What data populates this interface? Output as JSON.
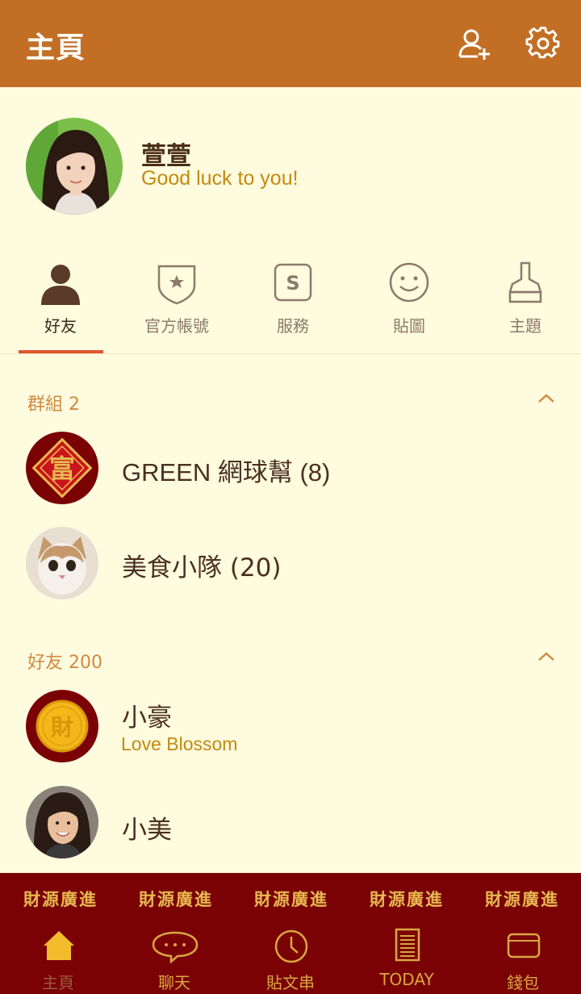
{
  "header": {
    "title": "主頁"
  },
  "profile": {
    "name": "萱萱",
    "status": "Good luck to you!"
  },
  "tabs": [
    {
      "label": "好友",
      "icon": "person-icon",
      "active": true
    },
    {
      "label": "官方帳號",
      "icon": "shield-star-icon"
    },
    {
      "label": "服務",
      "icon": "service-s-icon"
    },
    {
      "label": "貼圖",
      "icon": "smiley-icon"
    },
    {
      "label": "主題",
      "icon": "brush-icon"
    }
  ],
  "groups": {
    "header": "群組 2",
    "items": [
      {
        "name": "GREEN 網球幫 (8)",
        "avatar": "fu-charm-avatar"
      },
      {
        "name": "美食小隊 (20)",
        "avatar": "cat-avatar"
      }
    ]
  },
  "friends": {
    "header": "好友 200",
    "items": [
      {
        "name": "小豪",
        "status": "Love Blossom",
        "avatar": "gold-coin-avatar"
      },
      {
        "name": "小美",
        "avatar": "woman-avatar"
      }
    ]
  },
  "banner": [
    "財源廣進",
    "財源廣進",
    "財源廣進",
    "財源廣進",
    "財源廣進"
  ],
  "bottom_nav": [
    {
      "label": "主頁",
      "icon": "home-icon",
      "active": true
    },
    {
      "label": "聊天",
      "icon": "chat-icon"
    },
    {
      "label": "貼文串",
      "icon": "clock-icon"
    },
    {
      "label": "TODAY",
      "icon": "news-icon"
    },
    {
      "label": "錢包",
      "icon": "wallet-icon"
    }
  ],
  "colors": {
    "header": "#C26F25",
    "background": "#FFFBDF",
    "bottom_bar": "#7A0205",
    "accent": "#E05530",
    "status_text": "#C28A10"
  }
}
